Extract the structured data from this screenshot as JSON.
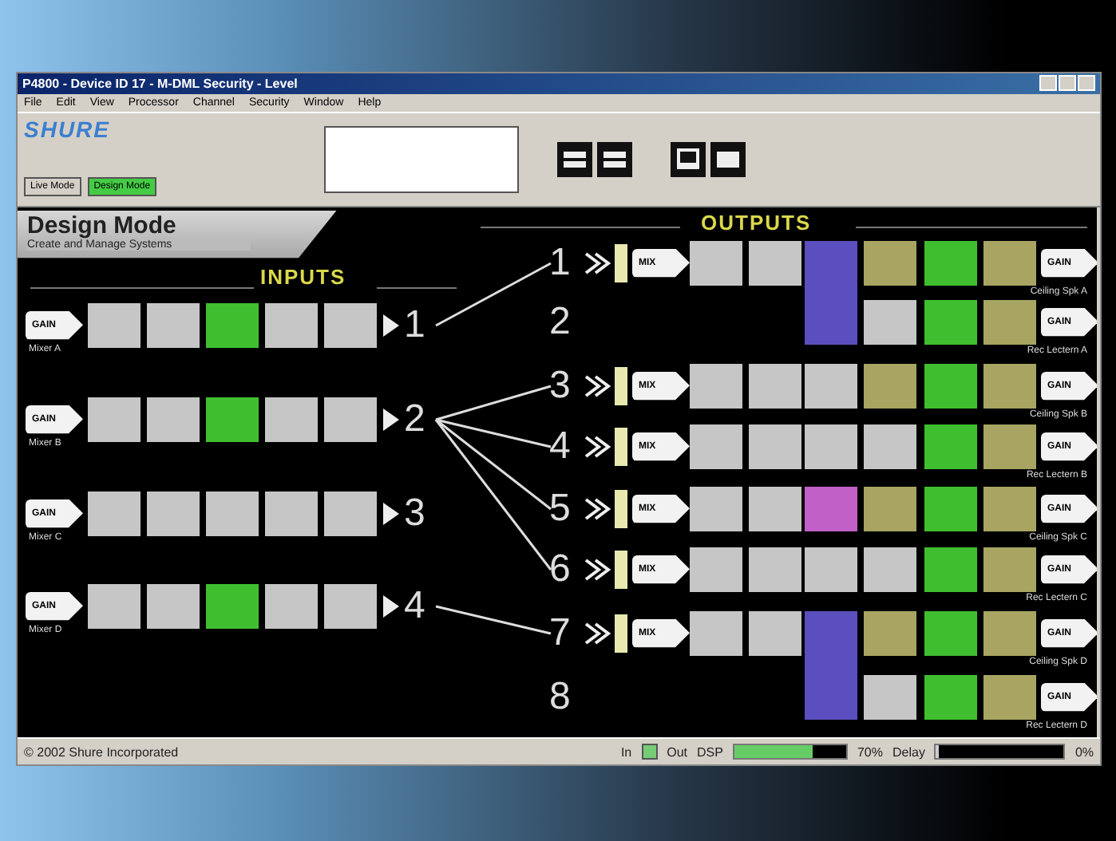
{
  "window": {
    "title": "P4800 - Device ID 17 - M-DML Security - Level"
  },
  "menu": [
    "File",
    "Edit",
    "View",
    "Processor",
    "Channel",
    "Security",
    "Window",
    "Help"
  ],
  "toolbar": {
    "logo": "SHURE",
    "modes": [
      {
        "label": "Live Mode",
        "selected": false
      },
      {
        "label": "Design Mode",
        "selected": true
      }
    ]
  },
  "mode_panel": {
    "title": "Design Mode",
    "subtitle": "Create and Manage Systems"
  },
  "inputs_heading": "INPUTS",
  "outputs_heading": "OUTPUTS",
  "inputs": [
    {
      "number": "1",
      "label": "Mixer A",
      "gain": "GAIN",
      "blocks": [
        {
          "kind": "plain"
        },
        {
          "kind": "plain"
        },
        {
          "kind": "eq"
        },
        {
          "kind": "plain"
        },
        {
          "kind": "plain"
        }
      ]
    },
    {
      "number": "2",
      "label": "Mixer B",
      "gain": "GAIN",
      "blocks": [
        {
          "kind": "plain"
        },
        {
          "kind": "plain"
        },
        {
          "kind": "eq"
        },
        {
          "kind": "plain"
        },
        {
          "kind": "plain"
        }
      ]
    },
    {
      "number": "3",
      "label": "Mixer C",
      "gain": "GAIN",
      "blocks": [
        {
          "kind": "plain"
        },
        {
          "kind": "plain"
        },
        {
          "kind": "plain"
        },
        {
          "kind": "plain"
        },
        {
          "kind": "plain"
        }
      ]
    },
    {
      "number": "4",
      "label": "Mixer D",
      "gain": "GAIN",
      "blocks": [
        {
          "kind": "plain"
        },
        {
          "kind": "plain"
        },
        {
          "kind": "eq"
        },
        {
          "kind": "plain"
        },
        {
          "kind": "plain"
        }
      ]
    }
  ],
  "outputs": [
    {
      "number": "1",
      "kind": "channel",
      "link": {
        "kind": "first"
      },
      "mix": "MIX",
      "gain": "GAIN",
      "label": "Ceiling Spk A",
      "blocks": [
        {
          "kind": "plain"
        },
        {
          "kind": "plain"
        },
        {
          "kind": "splitter"
        },
        {
          "kind": "filter"
        },
        {
          "kind": "eq"
        },
        {
          "kind": "filter"
        }
      ]
    },
    {
      "number": "2",
      "kind": "branch",
      "gain": "GAIN",
      "label": "Rec Lectern A",
      "blocks": [
        {
          "kind": "plain"
        },
        {
          "kind": "eq"
        },
        {
          "kind": "filter"
        }
      ]
    },
    {
      "number": "3",
      "kind": "channel",
      "link": {
        "kind": "second"
      },
      "mix": "MIX",
      "gain": "GAIN",
      "label": "Ceiling Spk B",
      "blocks": [
        {
          "kind": "plain"
        },
        {
          "kind": "plain"
        },
        {
          "kind": "plain"
        },
        {
          "kind": "filter"
        },
        {
          "kind": "eq"
        },
        {
          "kind": "filter"
        }
      ]
    },
    {
      "number": "4",
      "kind": "channel",
      "link": {
        "kind": "second"
      },
      "mix": "MIX",
      "gain": "GAIN",
      "label": "Rec Lectern B",
      "blocks": [
        {
          "kind": "plain"
        },
        {
          "kind": "plain"
        },
        {
          "kind": "plain"
        },
        {
          "kind": "plain"
        },
        {
          "kind": "eq"
        },
        {
          "kind": "filter"
        }
      ]
    },
    {
      "number": "5",
      "kind": "channel",
      "link": {
        "kind": "second"
      },
      "mix": "MIX",
      "gain": "GAIN",
      "label": "Ceiling Spk C",
      "blocks": [
        {
          "kind": "plain"
        },
        {
          "kind": "plain"
        },
        {
          "kind": "delay"
        },
        {
          "kind": "filter"
        },
        {
          "kind": "eq"
        },
        {
          "kind": "filter"
        }
      ]
    },
    {
      "number": "6",
      "kind": "channel",
      "link": {
        "kind": "second"
      },
      "mix": "MIX",
      "gain": "GAIN",
      "label": "Rec Lectern C",
      "blocks": [
        {
          "kind": "plain"
        },
        {
          "kind": "plain"
        },
        {
          "kind": "plain"
        },
        {
          "kind": "plain"
        },
        {
          "kind": "eq"
        },
        {
          "kind": "filter"
        }
      ]
    },
    {
      "number": "7",
      "kind": "channel",
      "link": {
        "kind": "fourth"
      },
      "mix": "MIX",
      "gain": "GAIN",
      "label": "Ceiling Spk D",
      "blocks": [
        {
          "kind": "plain"
        },
        {
          "kind": "plain"
        },
        {
          "kind": "splitter"
        },
        {
          "kind": "filter"
        },
        {
          "kind": "eq"
        },
        {
          "kind": "filter"
        }
      ]
    },
    {
      "number": "8",
      "kind": "branch",
      "gain": "GAIN",
      "label": "Rec Lectern D",
      "blocks": [
        {
          "kind": "plain"
        },
        {
          "kind": "eq"
        },
        {
          "kind": "filter"
        }
      ]
    }
  ],
  "status_bar": {
    "copyright": "© 2002 Shure Incorporated",
    "in_label": "In",
    "out_label": "Out",
    "dsp_label": "DSP",
    "dsp_level": {
      "level": 0.7
    },
    "dsp_reading": "70%",
    "delay_label": "Delay",
    "delay_level": {
      "level": 0.02
    },
    "delay_reading": "0%"
  }
}
